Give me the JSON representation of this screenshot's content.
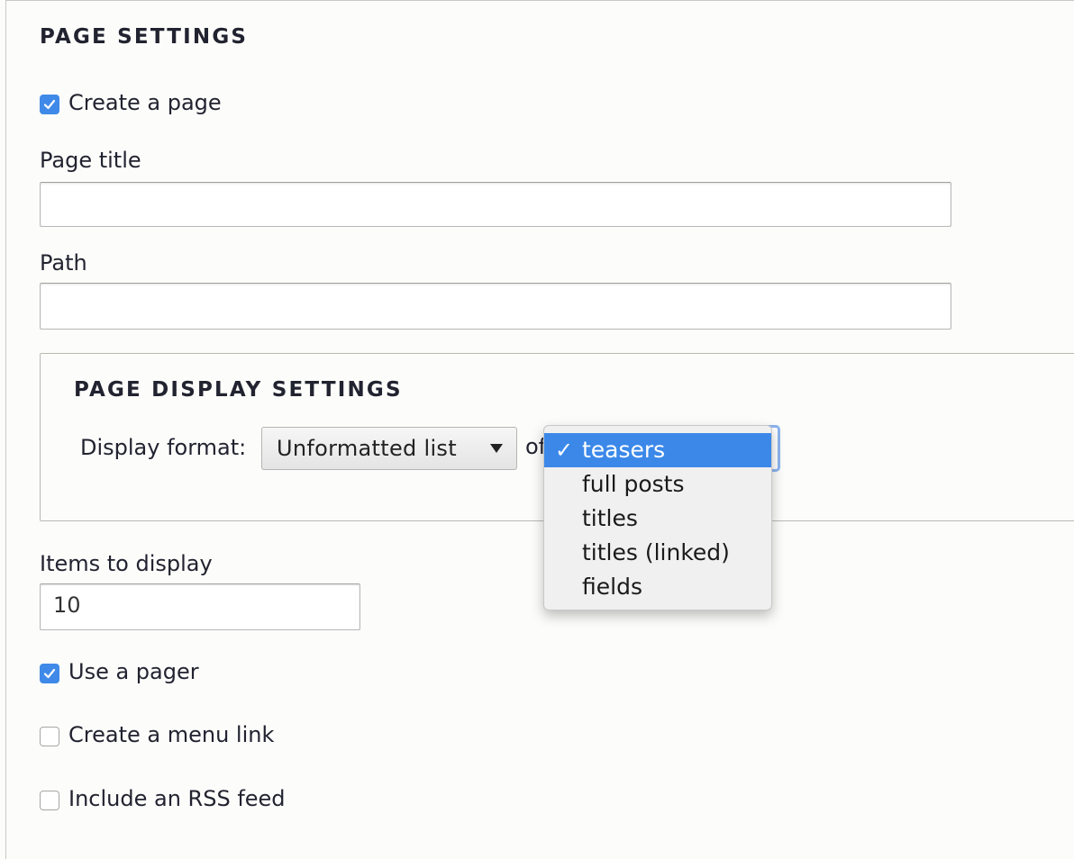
{
  "page_settings": {
    "title": "PAGE SETTINGS",
    "create_page": {
      "label": "Create a page",
      "checked": true
    },
    "page_title": {
      "label": "Page title",
      "value": ""
    },
    "path": {
      "label": "Path",
      "value": ""
    }
  },
  "page_display_settings": {
    "title": "PAGE DISPLAY SETTINGS",
    "display_format_label": "Display format:",
    "display_format_value": "Unformatted list",
    "of_label": "of",
    "dropdown": {
      "selected": "teasers",
      "check_mark": "✓",
      "options": [
        "teasers",
        "full posts",
        "titles",
        "titles (linked)",
        "fields"
      ]
    }
  },
  "items_to_display": {
    "label": "Items to display",
    "value": "10"
  },
  "use_pager": {
    "label": "Use a pager",
    "checked": true
  },
  "create_menu_link": {
    "label": "Create a menu link",
    "checked": false
  },
  "include_rss": {
    "label": "Include an RSS feed",
    "checked": false
  },
  "colors": {
    "accent": "#3b88e9",
    "checkbox_checked": "#3f8ae8",
    "text": "#222330",
    "background": "#fcfcfa"
  }
}
